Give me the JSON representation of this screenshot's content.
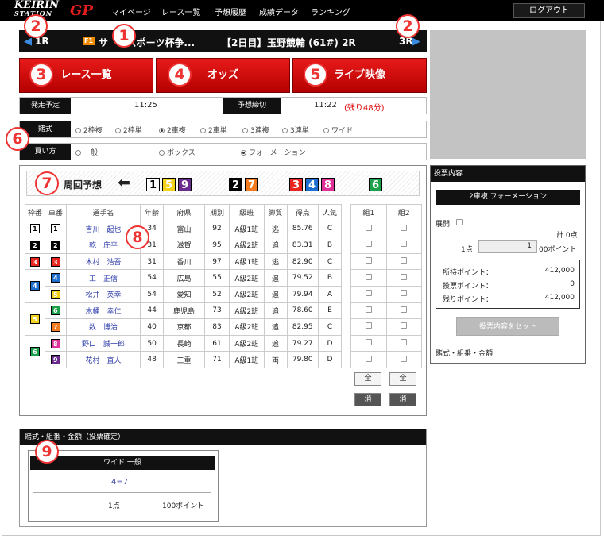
{
  "header": {
    "logo_top": "KEIRIN",
    "logo_bottom": "STATION",
    "logo_mark": "GP",
    "nav": [
      "マイページ",
      "レース一覧",
      "予想履歴",
      "成績データ",
      "ランキング"
    ],
    "logout": "ログアウト"
  },
  "race": {
    "prev": "1R",
    "next": "3R",
    "grade": "F1",
    "title": "サ　イスポーツ杯争...",
    "day": "【2日目】",
    "venue": "玉野競輪 (61#) 2R"
  },
  "tabs": [
    "レース一覧",
    "オッズ",
    "ライブ映像"
  ],
  "times": {
    "start_label": "発走予定",
    "start": "11:25",
    "deadline_label": "予想締切",
    "deadline": "11:22",
    "remaining": "(残り48分)"
  },
  "bet_type": {
    "label": "賭式",
    "options": [
      "2枠複",
      "2枠単",
      "2車複",
      "2車単",
      "3連複",
      "3連単",
      "ワイド"
    ],
    "selected": "2車複"
  },
  "buy_method": {
    "label": "買い方",
    "options": [
      "一般",
      "ボックス",
      "フォーメーション"
    ],
    "selected": "フォーメーション"
  },
  "prediction": {
    "label": "周回予想",
    "groups": [
      [
        "1",
        "5",
        "9"
      ],
      [
        "2",
        "7"
      ],
      [
        "3",
        "4",
        "8"
      ],
      [
        "6"
      ]
    ]
  },
  "table": {
    "headers": [
      "枠番",
      "車番",
      "選手名",
      "年齢",
      "府県",
      "期別",
      "級班",
      "脚質",
      "得点",
      "人気"
    ],
    "rows": [
      [
        "1",
        "1",
        "吉川　起也",
        "34",
        "富山",
        "92",
        "A級1班",
        "逃",
        "85.76",
        "C"
      ],
      [
        "2",
        "2",
        "乾　庄平",
        "31",
        "滋賀",
        "95",
        "A級2班",
        "追",
        "83.31",
        "B"
      ],
      [
        "3",
        "3",
        "木村　浩吾",
        "31",
        "香川",
        "97",
        "A級1班",
        "逃",
        "82.90",
        "C"
      ],
      [
        "4",
        "4",
        "工　正信",
        "54",
        "広島",
        "55",
        "A級2班",
        "追",
        "79.52",
        "B"
      ],
      [
        "4",
        "5",
        "松井　英幸",
        "54",
        "愛知",
        "52",
        "A級2班",
        "追",
        "79.94",
        "A"
      ],
      [
        "5",
        "6",
        "木幡　幸仁",
        "44",
        "鹿児島",
        "73",
        "A級2班",
        "追",
        "78.60",
        "E"
      ],
      [
        "5",
        "7",
        "数　博治",
        "40",
        "京都",
        "83",
        "A級2班",
        "追",
        "82.95",
        "C"
      ],
      [
        "6",
        "8",
        "野口　誠一郎",
        "50",
        "長崎",
        "61",
        "A級2班",
        "追",
        "79.27",
        "D"
      ],
      [
        "6",
        "9",
        "花村　直人",
        "48",
        "三重",
        "71",
        "A級1班",
        "両",
        "79.80",
        "D"
      ]
    ],
    "sel_headers": [
      "組1",
      "組2"
    ],
    "all_label": "全",
    "clear_label": "消"
  },
  "side": {
    "title": "投票内容",
    "bet_name": "2車複 フォーメーション",
    "expand_label": "展開",
    "total": "計 0点",
    "points_label": "1点",
    "points_value": "1",
    "points_unit": "00ポイント",
    "held_label": "所持ポイント：",
    "held": "412,000",
    "vote_label": "投票ポイント：",
    "vote": "0",
    "rest_label": "残りポイント：",
    "rest": "412,000",
    "set_button": "投票内容をセット",
    "footer": "賭式・組番・金額"
  },
  "confirmed": {
    "title": "賭式・組番・金額（投票確定）",
    "bet_name": "ワイド 一般",
    "combo": "4=7",
    "count": "1点",
    "amount": "100ポイント"
  },
  "markers": [
    "1",
    "2",
    "2",
    "3",
    "4",
    "5",
    "6",
    "7",
    "8",
    "9"
  ],
  "colors": {
    "accent_red": "#e33333",
    "frame1": "#ffffff",
    "frame2": "#000000",
    "frame3": "#e8261f",
    "frame4": "#1f6fd1",
    "frame5": "#f2d21b",
    "frame6": "#1aa14a",
    "frame7": "#f47a20",
    "frame8": "#e0309a",
    "frame9": "#6a2a8e"
  }
}
